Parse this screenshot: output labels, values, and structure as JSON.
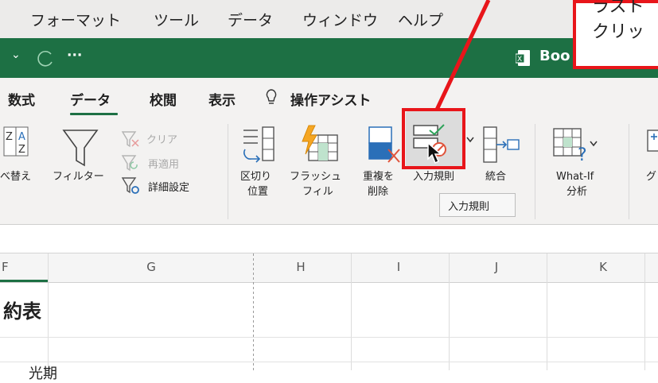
{
  "menubar": {
    "items": [
      "フォーマット",
      "ツール",
      "データ",
      "ウィンドウ",
      "ヘルプ"
    ]
  },
  "titlebar": {
    "chevron": "⌄",
    "more": "···",
    "book_title": "Boo"
  },
  "ribbon": {
    "tabs": [
      "数式",
      "データ",
      "校閲",
      "表示",
      "操作アシスト"
    ],
    "active_tab": "データ",
    "commands": {
      "sort_label": "べ替え",
      "filter_label": "フィルター",
      "clear_label": "クリア",
      "reapply_label": "再適用",
      "advanced_label": "詳細設定",
      "text_to_columns_line1": "区切り",
      "text_to_columns_line2": "位置",
      "flash_fill_line1": "フラッシュ",
      "flash_fill_line2": "フィル",
      "remove_dup_line1": "重複を",
      "remove_dup_line2": "削除",
      "data_validation_label": "入力規則",
      "consolidate_label": "統合",
      "what_if_line1": "What-If",
      "what_if_line2": "分析",
      "group_label": "グ"
    },
    "tooltip": "入力規則"
  },
  "grid": {
    "columns": [
      "F",
      "G",
      "H",
      "I",
      "J",
      "K"
    ],
    "title_cell": "約表",
    "bottom_cell": "光期"
  },
  "callout": {
    "line1": "ラスト",
    "line2": "クリッ"
  },
  "colors": {
    "title_green": "#1d7044",
    "annotation_red": "#e8151a",
    "ribbon_bg": "#f3f2f1"
  }
}
